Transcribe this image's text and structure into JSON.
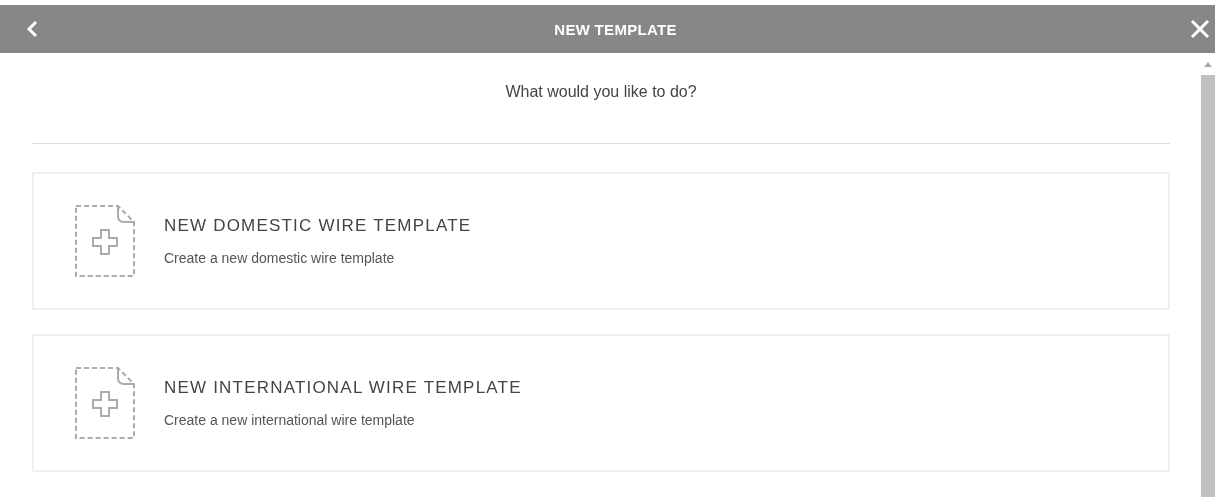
{
  "header": {
    "title": "NEW TEMPLATE"
  },
  "prompt": "What would you like to do?",
  "options": [
    {
      "title": "NEW DOMESTIC WIRE TEMPLATE",
      "description": "Create a new domestic wire template"
    },
    {
      "title": "NEW INTERNATIONAL WIRE TEMPLATE",
      "description": "Create a new international wire template"
    }
  ]
}
